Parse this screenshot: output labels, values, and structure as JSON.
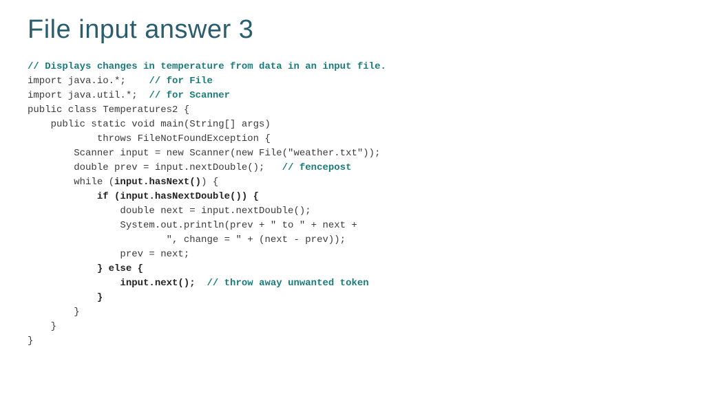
{
  "title": "File input answer 3",
  "code": {
    "c_top": "// Displays changes in temperature from data in an input file.",
    "l_blank1": "",
    "l_imp1a": "import java.io.*;    ",
    "c_imp1": "// for File",
    "l_imp2a": "import java.util.*;  ",
    "c_imp2": "// for Scanner",
    "l_blank2": "",
    "l_class": "public class Temperatures2 {",
    "l_main": "    public static void main(String[] args)",
    "l_throws": "            throws FileNotFoundException {",
    "l_scanner": "        Scanner input = new Scanner(new File(\"weather.txt\"));",
    "l_prev_a": "        double prev = input.nextDouble();   ",
    "c_prev": "// fencepost",
    "l_while_a": "        while (",
    "l_while_b": "input.hasNext()",
    "l_while_c": ") {",
    "l_if_a": "            ",
    "l_if_b": "if (input.hasNextDouble()) {",
    "l_next": "                double next = input.nextDouble();",
    "l_out1": "                System.out.println(prev + \" to \" + next +",
    "l_out2": "                        \", change = \" + (next - prev));",
    "l_assign": "                prev = next;",
    "l_else_a": "            ",
    "l_else_b": "} else {",
    "l_inputnext_a": "                ",
    "l_inputnext_b": "input.next();",
    "l_inputnext_c": "  ",
    "c_inputnext": "// throw away unwanted token",
    "l_closeif_a": "            ",
    "l_closeif_b": "}",
    "l_closewhile": "        }",
    "l_closemain": "    }",
    "l_closeclass": "}"
  }
}
